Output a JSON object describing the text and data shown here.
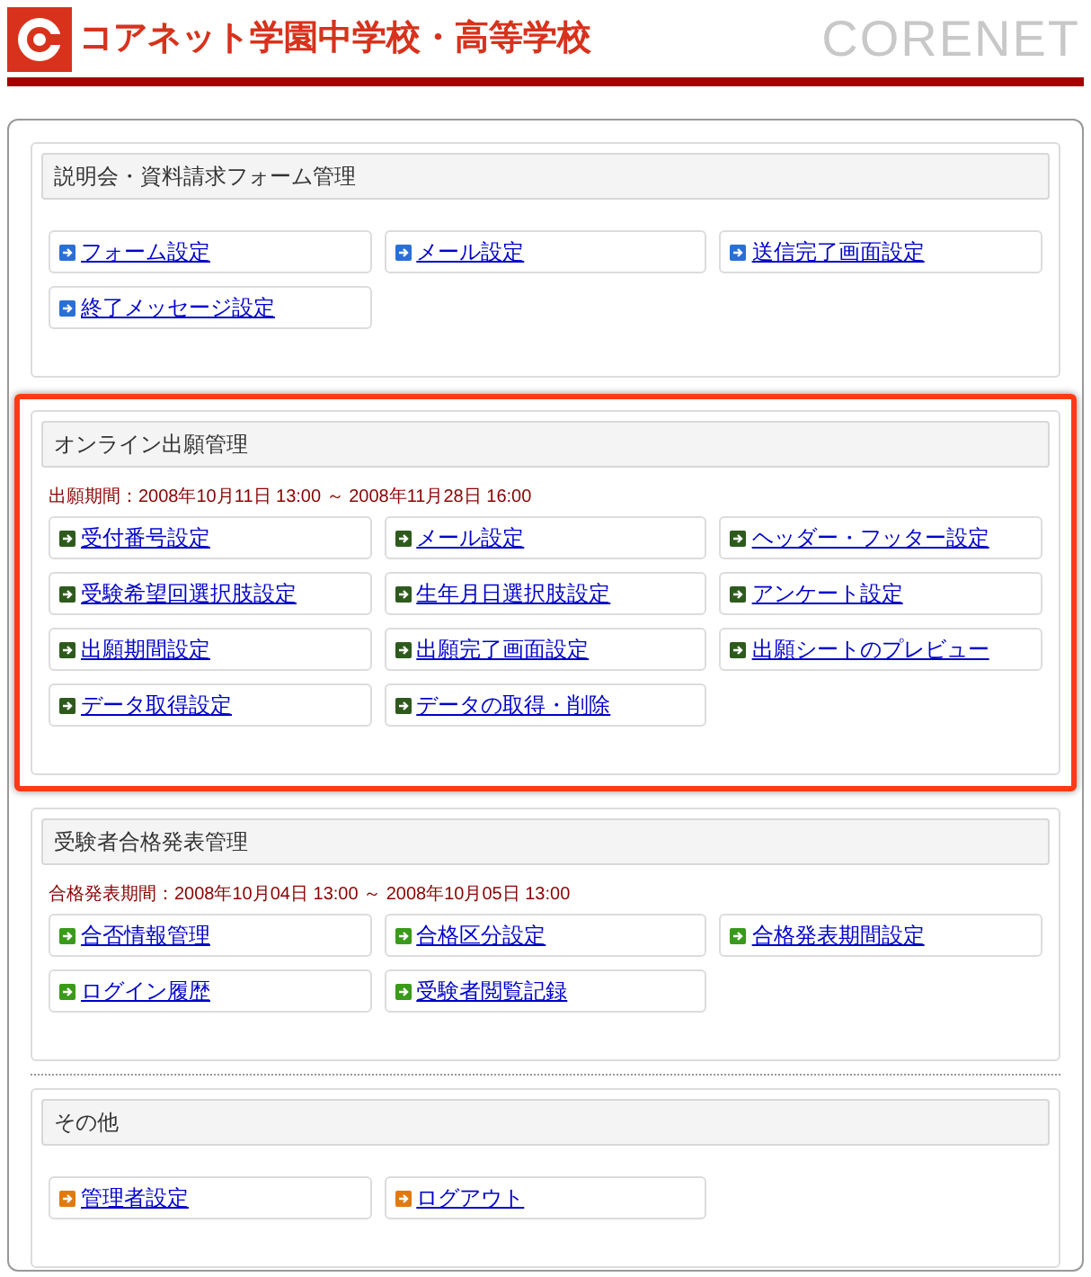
{
  "header": {
    "logo_text": "コアネット学園中学校・高等学校",
    "brand": "CORENET"
  },
  "sections": [
    {
      "title": "説明会・資料請求フォーム管理",
      "highlighted": false,
      "color": "#2a6fd6",
      "links": [
        "フォーム設定",
        "メール設定",
        "送信完了画面設定",
        "終了メッセージ設定"
      ]
    },
    {
      "title": "オンライン出願管理",
      "highlighted": true,
      "color": "#2f5a1e",
      "period": "出願期間：2008年10月11日 13:00 ～ 2008年11月28日 16:00",
      "links": [
        "受付番号設定",
        "メール設定",
        "ヘッダー・フッター設定",
        "受験希望回選択肢設定",
        "生年月日選択肢設定",
        "アンケート設定",
        "出願期間設定",
        "出願完了画面設定",
        "出願シートのプレビュー",
        "データ取得設定",
        "データの取得・削除"
      ]
    },
    {
      "title": "受験者合格発表管理",
      "highlighted": false,
      "color": "#3a9a1a",
      "period": "合格発表期間：2008年10月04日 13:00 ～ 2008年10月05日 13:00",
      "links": [
        "合否情報管理",
        "合格区分設定",
        "合格発表期間設定",
        "ログイン履歴",
        "受験者閲覧記録"
      ]
    },
    {
      "title": "その他",
      "highlighted": false,
      "color": "#e07a10",
      "links": [
        "管理者設定",
        "ログアウト"
      ]
    }
  ]
}
